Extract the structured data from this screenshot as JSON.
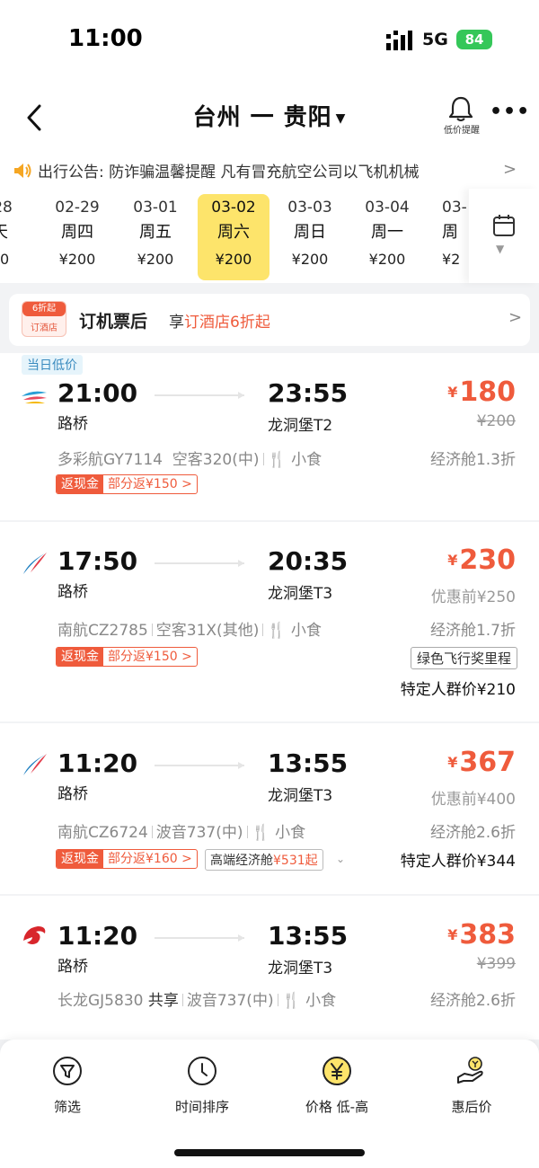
{
  "status": {
    "time": "11:00",
    "network": "5G",
    "battery": "84"
  },
  "header": {
    "from": "台州",
    "to": "贵阳",
    "arrow": "一",
    "bell_label": "低价提醒"
  },
  "notice": {
    "text": "出行公告: 防诈骗温馨提醒  凡有冒充航空公司以飞机机械"
  },
  "dates": [
    {
      "date": "-28",
      "weekday": "天",
      "price": "00"
    },
    {
      "date": "02-29",
      "weekday": "周四",
      "price": "¥200"
    },
    {
      "date": "03-01",
      "weekday": "周五",
      "price": "¥200"
    },
    {
      "date": "03-02",
      "weekday": "周六",
      "price": "¥200"
    },
    {
      "date": "03-03",
      "weekday": "周日",
      "price": "¥200"
    },
    {
      "date": "03-04",
      "weekday": "周一",
      "price": "¥200"
    },
    {
      "date": "03-",
      "weekday": "周",
      "price": "¥2"
    }
  ],
  "promo": {
    "badge_top": "6折起",
    "badge_bottom": "订酒店",
    "main": "订机票后",
    "sub_prefix": "享",
    "sub_highlight": "订酒店6折起"
  },
  "flights": [
    {
      "tag": "当日低价",
      "dep_time": "21:00",
      "arr_time": "23:55",
      "dep_airport": "路桥",
      "arr_airport": "龙洞堡T2",
      "currency": "¥",
      "price": "180",
      "orig_price": "¥200",
      "airline_flight": "多彩航GY7114",
      "aircraft": "空客320(中)",
      "meal": "小食",
      "cabin": "经济舱1.3折",
      "cash_label": "返现金",
      "cash_value": "部分返¥150 >"
    },
    {
      "dep_time": "17:50",
      "arr_time": "20:35",
      "dep_airport": "路桥",
      "arr_airport": "龙洞堡T3",
      "currency": "¥",
      "price": "230",
      "orig_price": "优惠前¥250",
      "airline_flight": "南航CZ2785",
      "aircraft": "空客31X(其他)",
      "meal": "小食",
      "cabin": "经济舱1.7折",
      "cash_label": "返现金",
      "cash_value": "部分返¥150 >",
      "green_tag": "绿色飞行奖里程",
      "special": "特定人群价¥210"
    },
    {
      "dep_time": "11:20",
      "arr_time": "13:55",
      "dep_airport": "路桥",
      "arr_airport": "龙洞堡T3",
      "currency": "¥",
      "price": "367",
      "orig_price": "优惠前¥400",
      "airline_flight": "南航CZ6724",
      "aircraft": "波音737(中)",
      "meal": "小食",
      "cabin": "经济舱2.6折",
      "cash_label": "返现金",
      "cash_value": "部分返¥160 >",
      "hiend_prefix": "高端经济舱",
      "hiend_value": "¥531起",
      "special": "特定人群价¥344"
    },
    {
      "dep_time": "11:20",
      "arr_time": "13:55",
      "dep_airport": "路桥",
      "arr_airport": "龙洞堡T3",
      "currency": "¥",
      "price": "383",
      "orig_price": "¥399",
      "airline_flight": "长龙GJ5830",
      "share": "共享",
      "aircraft": "波音737(中)",
      "meal": "小食",
      "cabin": "经济舱2.6折"
    }
  ],
  "bottom_tabs": [
    {
      "label": "筛选",
      "icon": "filter-icon"
    },
    {
      "label": "时间排序",
      "icon": "clock-icon"
    },
    {
      "label": "价格 低-高",
      "icon": "yen-icon"
    },
    {
      "label": "惠后价",
      "icon": "money-hand-icon"
    }
  ],
  "colors": {
    "accent": "#ef5b3c",
    "selected_date": "#fde46b",
    "battery": "#35c759"
  }
}
